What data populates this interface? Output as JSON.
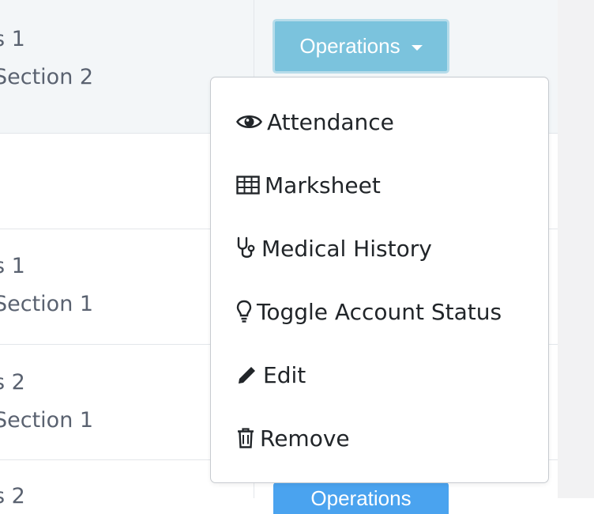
{
  "table": {
    "rows": [
      {
        "line1": "s 1",
        "line2": "Section 2"
      },
      {
        "line1": "",
        "line2": ""
      },
      {
        "line1": "s 1",
        "line2": "Section 1"
      },
      {
        "line1": "s 2",
        "line2": "Section 1"
      },
      {
        "line1": "s 2",
        "line2": ""
      }
    ]
  },
  "operations_button": {
    "label": "Operations"
  },
  "operations_button_bottom": {
    "label": "Operations"
  },
  "dropdown": {
    "items": [
      {
        "label": "Attendance",
        "icon": "eye-icon"
      },
      {
        "label": "Marksheet",
        "icon": "table-icon"
      },
      {
        "label": "Medical History",
        "icon": "stethoscope-icon"
      },
      {
        "label": "Toggle Account Status",
        "icon": "lightbulb-icon"
      },
      {
        "label": "Edit",
        "icon": "pencil-icon"
      },
      {
        "label": "Remove",
        "icon": "trash-icon"
      }
    ]
  },
  "colors": {
    "button_active": "#7bc3dd",
    "button_primary": "#4aa3ef",
    "row_alt": "#f3f6f8",
    "text_muted": "#5a6270",
    "text_dark": "#212529"
  }
}
